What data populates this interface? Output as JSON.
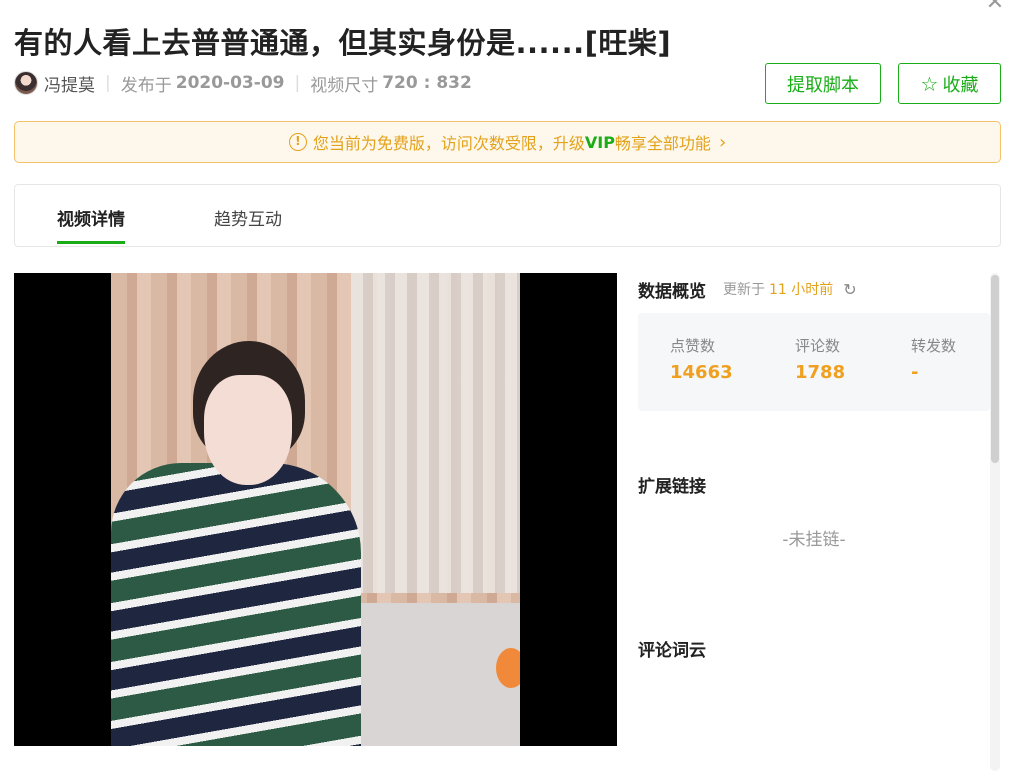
{
  "title": "有的人看上去普普通通，但其实身份是......[旺柴]",
  "author": "冯提莫",
  "publish": {
    "label": "发布于",
    "date": "2020-03-09"
  },
  "size": {
    "label": "视频尺寸",
    "value": "720 : 832"
  },
  "buttons": {
    "extract": "提取脚本",
    "favorite": "收藏"
  },
  "notice": {
    "prefix": "您当前为免费版，访问次数受限，升级",
    "vip": "VIP",
    "suffix": "畅享全部功能"
  },
  "tabs": {
    "detail": "视频详情",
    "trend": "趋势互动"
  },
  "overview": {
    "heading": "数据概览",
    "updated_prefix": "更新于",
    "updated_value": "11 小时前",
    "stats": {
      "likes_label": "点赞数",
      "likes": "14663",
      "comments_label": "评论数",
      "comments": "1788",
      "shares_label": "转发数",
      "shares": "-"
    }
  },
  "links": {
    "heading": "扩展链接",
    "empty": "-未挂链-"
  },
  "wordcloud": {
    "heading": "评论词云"
  },
  "colors": {
    "accent": "#1aad19",
    "warning": "#e3a21b",
    "number": "#f0a020"
  },
  "icons": [
    "close-icon",
    "star-icon",
    "info-icon",
    "chevron-right-icon",
    "refresh-icon"
  ]
}
